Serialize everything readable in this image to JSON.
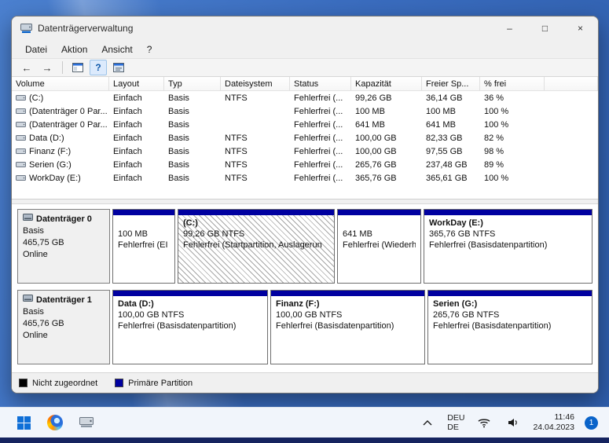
{
  "window": {
    "title": "Datenträgerverwaltung",
    "menu": [
      "Datei",
      "Aktion",
      "Ansicht",
      "?"
    ],
    "toolbar": {
      "back": "←",
      "forward": "→",
      "help": "?"
    },
    "controls": {
      "minimize": "–",
      "maximize": "□",
      "close": "×"
    }
  },
  "table": {
    "columns": [
      "Volume",
      "Layout",
      "Typ",
      "Dateisystem",
      "Status",
      "Kapazität",
      "Freier Sp...",
      "% frei"
    ],
    "rows": [
      [
        "(C:)",
        "Einfach",
        "Basis",
        "NTFS",
        "Fehlerfrei (...",
        "99,26 GB",
        "36,14 GB",
        "36 %"
      ],
      [
        "(Datenträger 0 Par...",
        "Einfach",
        "Basis",
        "",
        "Fehlerfrei (...",
        "100 MB",
        "100 MB",
        "100 %"
      ],
      [
        "(Datenträger 0 Par...",
        "Einfach",
        "Basis",
        "",
        "Fehlerfrei (...",
        "641 MB",
        "641 MB",
        "100 %"
      ],
      [
        "Data (D:)",
        "Einfach",
        "Basis",
        "NTFS",
        "Fehlerfrei (...",
        "100,00 GB",
        "82,33 GB",
        "82 %"
      ],
      [
        "Finanz (F:)",
        "Einfach",
        "Basis",
        "NTFS",
        "Fehlerfrei (...",
        "100,00 GB",
        "97,55 GB",
        "98 %"
      ],
      [
        "Serien (G:)",
        "Einfach",
        "Basis",
        "NTFS",
        "Fehlerfrei (...",
        "265,76 GB",
        "237,48 GB",
        "89 %"
      ],
      [
        "WorkDay (E:)",
        "Einfach",
        "Basis",
        "NTFS",
        "Fehlerfrei (...",
        "365,76 GB",
        "365,61 GB",
        "100 %"
      ]
    ]
  },
  "disks": [
    {
      "name": "Datenträger 0",
      "type": "Basis",
      "size": "465,75 GB",
      "status": "Online",
      "partitions": [
        {
          "label": "",
          "size": "100 MB",
          "status": "Fehlerfrei (EI"
        },
        {
          "label": "(C:)",
          "size": "99,26 GB NTFS",
          "status": "Fehlerfrei (Startpartition, Auslagerun",
          "selected": true
        },
        {
          "label": "",
          "size": "641 MB",
          "status": "Fehlerfrei (Wiederh"
        },
        {
          "label": "WorkDay (E:)",
          "size": "365,76 GB NTFS",
          "status": "Fehlerfrei (Basisdatenpartition)"
        }
      ]
    },
    {
      "name": "Datenträger 1",
      "type": "Basis",
      "size": "465,76 GB",
      "status": "Online",
      "partitions": [
        {
          "label": "Data (D:)",
          "size": "100,00 GB NTFS",
          "status": "Fehlerfrei (Basisdatenpartition)"
        },
        {
          "label": "Finanz (F:)",
          "size": "100,00 GB NTFS",
          "status": "Fehlerfrei (Basisdatenpartition)"
        },
        {
          "label": "Serien (G:)",
          "size": "265,76 GB NTFS",
          "status": "Fehlerfrei (Basisdatenpartition)"
        }
      ]
    }
  ],
  "legend": [
    {
      "label": "Nicht zugeordnet",
      "color": "#000000"
    },
    {
      "label": "Primäre Partition",
      "color": "#0000a0"
    }
  ],
  "taskbar": {
    "language_line1": "DEU",
    "language_line2": "DE",
    "time": "11:46",
    "date": "24.04.2023",
    "notification_count": "1"
  },
  "colors": {
    "accent": "#0a63c9",
    "partition_header": "#0000a0",
    "desktop_blue": "#3a6cbe"
  }
}
